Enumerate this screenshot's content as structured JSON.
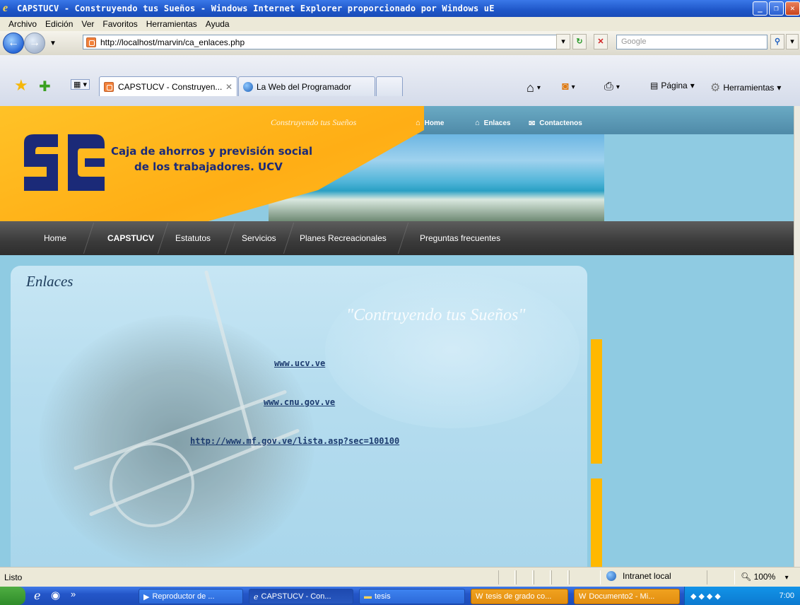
{
  "window": {
    "title": "CAPSTUCV - Construyendo tus Sueños - Windows Internet Explorer proporcionado por Windows uE"
  },
  "menu": [
    "Archivo",
    "Edición",
    "Ver",
    "Favoritos",
    "Herramientas",
    "Ayuda"
  ],
  "address": {
    "url": "http://localhost/marvin/ca_enlaces.php",
    "search_placeholder": "Google"
  },
  "tabs": [
    {
      "label": "CAPSTUCV - Construyen...",
      "active": true
    },
    {
      "label": "La Web del Programador",
      "active": false
    }
  ],
  "toolbar": {
    "page_label": "Página",
    "tools_label": "Herramientas"
  },
  "site": {
    "top_slogan": "Construyendo tus Sueños",
    "org_line1": "Caja de ahorros y previsión social",
    "org_line2": "de los trabajadores. UCV",
    "top_links": [
      "Home",
      "Enlaces",
      "Contactenos"
    ],
    "nav": [
      "Home",
      "CAPSTUCV",
      "Estatutos",
      "Servicios",
      "Planes Recreacionales",
      "Preguntas frecuentes"
    ]
  },
  "content": {
    "title": "Enlaces",
    "slogan": "\"Contruyendo tus Sueños\"",
    "links": [
      "www.ucv.ve",
      "www.cnu.gov.ve",
      "http://www.mf.gov.ve/lista.asp?sec=100100"
    ]
  },
  "status": {
    "text": "Listo",
    "zone": "Intranet local",
    "zoom": "100%"
  },
  "taskbar": {
    "items": [
      "Reproductor de ...",
      "CAPSTUCV - Con...",
      "tesis",
      "tesis de grado co...",
      "Documento2 - Mi..."
    ],
    "clock": "7:00"
  },
  "colors": {
    "accent_orange": "#ffb800",
    "page_bg": "#8fcbe2",
    "logo_blue": "#1b2a78"
  }
}
